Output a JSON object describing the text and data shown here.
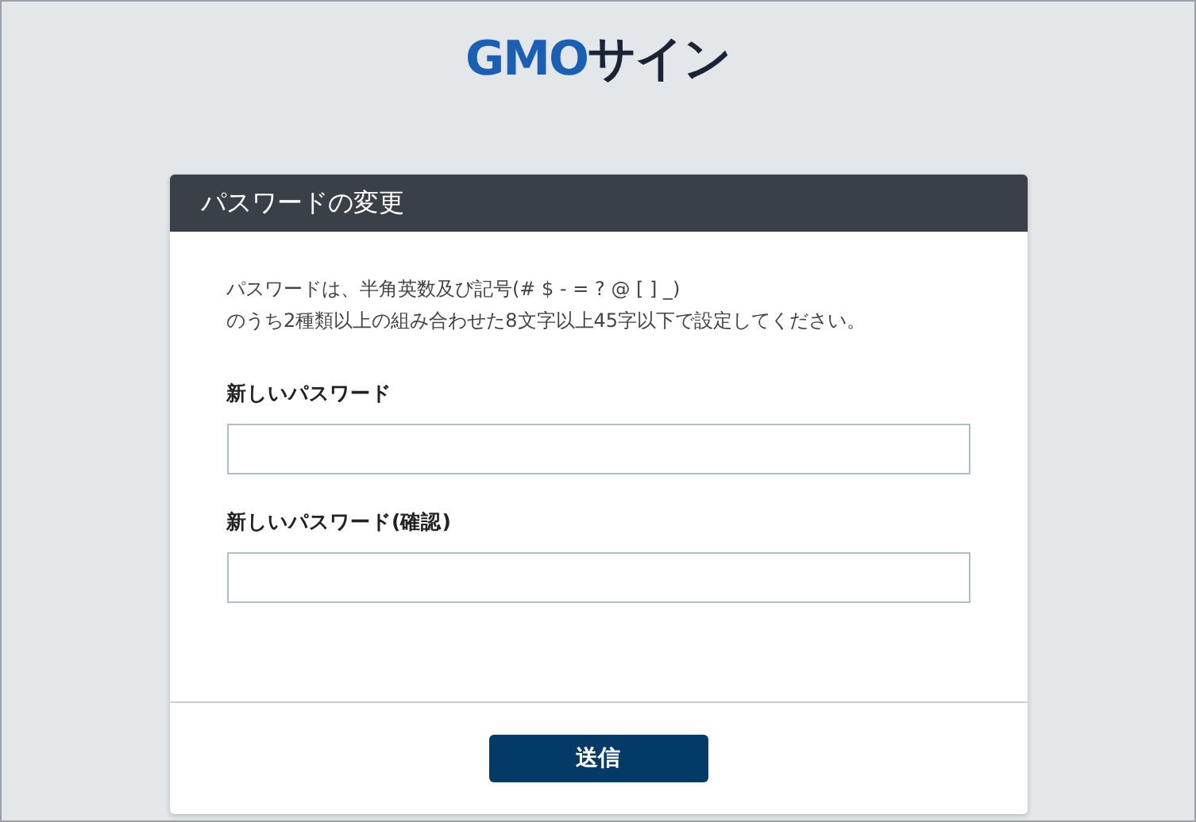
{
  "logo": {
    "parts": [
      {
        "text": "GMO",
        "color": "#1a5fb4"
      },
      {
        "text": "サイン",
        "color": "#1b2336"
      }
    ]
  },
  "card": {
    "title": "パスワードの変更",
    "description": [
      "パスワードは、半角英数及び記号(# $ - = ? @ [ ] _)",
      "のうち2種類以上の組み合わせた8文字以上45字以下で設定してください。"
    ],
    "fields": [
      {
        "label": "新しいパスワード"
      },
      {
        "label": "新しいパスワード(確認)"
      }
    ],
    "submit": "送信"
  }
}
